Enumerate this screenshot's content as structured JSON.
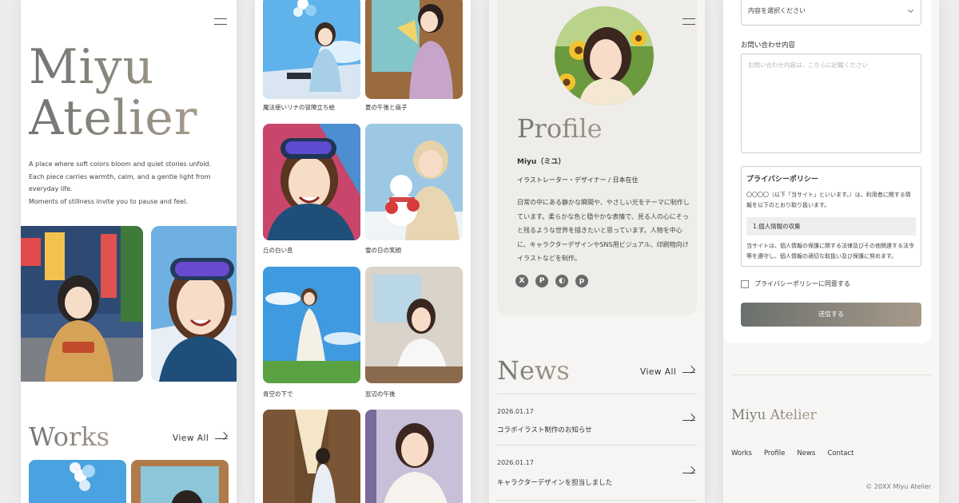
{
  "panel_home": {
    "hero_title_line1": "Miyu",
    "hero_title_line2": "Atelier",
    "hero_lines": [
      "A place where soft colors bloom and quiet stories unfold.",
      "Each piece carries warmth, calm, and a gentle light from everyday life.",
      "Moments of stillness invite you to pause and feel."
    ],
    "works_title": "Works",
    "view_all": "View All"
  },
  "panel_gallery": {
    "captions": [
      "魔法使いリナの冒険立ち絵",
      "夏の午後と扇子",
      "丘の白い息",
      "雪の日の笑顔",
      "青空の下で",
      "窓辺の午後"
    ]
  },
  "panel_profile": {
    "title": "Profile",
    "name": "Miyu（ミユ）",
    "role": "イラストレーター・デザイナー / 日本在住",
    "bio": "日常の中にある静かな瞬間や、やさしい光をテーマに制作しています。柔らかな色と穏やかな表情で、見る人の心にそっと残るような世界を描きたいと思っています。人物を中心に、キャラクターデザインやSNS用ビジュアル、印刷物向けイラストなどを制作。",
    "socials": [
      "x-icon",
      "pinterest-icon",
      "dribbble-icon",
      "pixiv-icon"
    ],
    "news_title": "News",
    "view_all": "View All",
    "news": [
      {
        "date": "2026.01.17",
        "text": "コラボイラスト制作のお知らせ"
      },
      {
        "date": "2026.01.17",
        "text": "キャラクターデザインを担当しました"
      }
    ]
  },
  "panel_contact": {
    "select_value": "内容を選択ください",
    "message_label": "お問い合わせ内容",
    "message_placeholder": "お問い合わせ内容は、こちらに記載ください",
    "policy_title": "プライバシーポリシー",
    "policy_intro": "〇〇〇〇（以下「当サイト」といいます。）は、利用者に関する情報を以下のとおり取り扱います。",
    "policy_section": "1.個人情報の収集",
    "policy_body": "当サイトは、個人情報の保護に関する法律及びその他関連する法令等を遵守し、個人情報の適切な取扱い及び保護に努めます。",
    "agree_label": "プライバシーポリシーに同意する",
    "submit_label": "送信する",
    "footer_logo": "Miyu Atelier",
    "footer_nav": [
      "Works",
      "Profile",
      "News",
      "Contact"
    ],
    "copyright": "© 20XX Miyu Atelier"
  },
  "colors": {
    "accent_start": "#6b706d",
    "accent_end": "#a89a8b"
  }
}
